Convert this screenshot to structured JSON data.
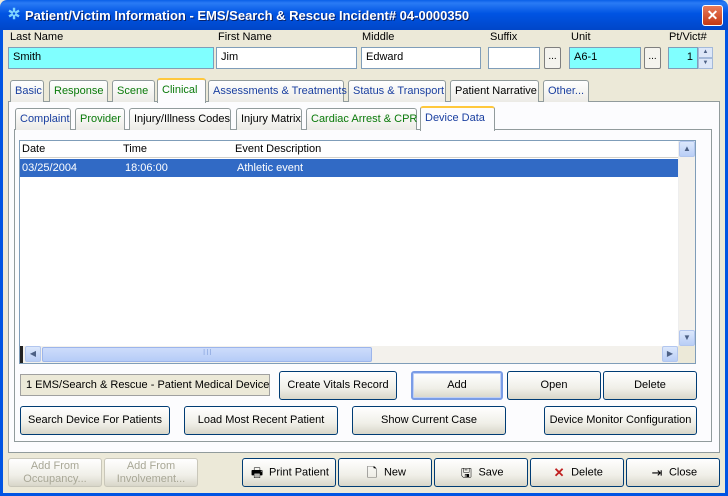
{
  "window": {
    "title": "Patient/Victim Information - EMS/Search & Rescue Incident# 04-0000350",
    "close_glyph": "✕",
    "icon_glyph": "✲"
  },
  "patient": {
    "last_name_label": "Last Name",
    "last_name": "Smith",
    "first_name_label": "First Name",
    "first_name": "Jim",
    "middle_label": "Middle",
    "middle": "Edward",
    "suffix_label": "Suffix",
    "suffix": "",
    "unit_label": "Unit",
    "unit": "A6-1",
    "ptvict_label": "Pt/Vict#",
    "ptvict": "1",
    "dots": "..."
  },
  "main_tabs": [
    "Basic",
    "Response",
    "Scene",
    "Clinical",
    "Assessments & Treatments",
    "Status & Transport",
    "Patient Narrative",
    "Other..."
  ],
  "sub_tabs": [
    "Complaint",
    "Provider",
    "Injury/Illness Codes",
    "Injury Matrix",
    "Cardiac Arrest & CPR",
    "Device Data"
  ],
  "table": {
    "columns": [
      "Date",
      "Time",
      "Event Description"
    ],
    "rows": [
      {
        "date": "03/25/2004",
        "time": "18:06:00",
        "event": "Athletic event"
      }
    ],
    "grip": "III"
  },
  "device_status": "1 EMS/Search & Rescue - Patient Medical Device",
  "buttons": {
    "create_vitals": "Create Vitals Record",
    "add": "Add",
    "open": "Open",
    "delete_row": "Delete",
    "search_device": "Search Device For Patients",
    "load_recent": "Load Most Recent Patient",
    "show_case": "Show Current Case",
    "device_config": "Device Monitor Configuration",
    "add_occupancy_1": "Add From",
    "add_occupancy_2": "Occupancy...",
    "add_involvement_1": "Add From",
    "add_involvement_2": "Involvement...",
    "print": "Print Patient",
    "new": "New",
    "save": "Save",
    "delete": "Delete",
    "close": "Close"
  },
  "icons": {
    "print": "🖶",
    "new": "🗋",
    "save": "🖫",
    "delete": "✕",
    "close": "⇥"
  },
  "colors": {
    "title_bar": "#0054E3",
    "required_field": "#80FFFF",
    "selection": "#316AC5",
    "active_tab_accent": "#FFC83C"
  }
}
